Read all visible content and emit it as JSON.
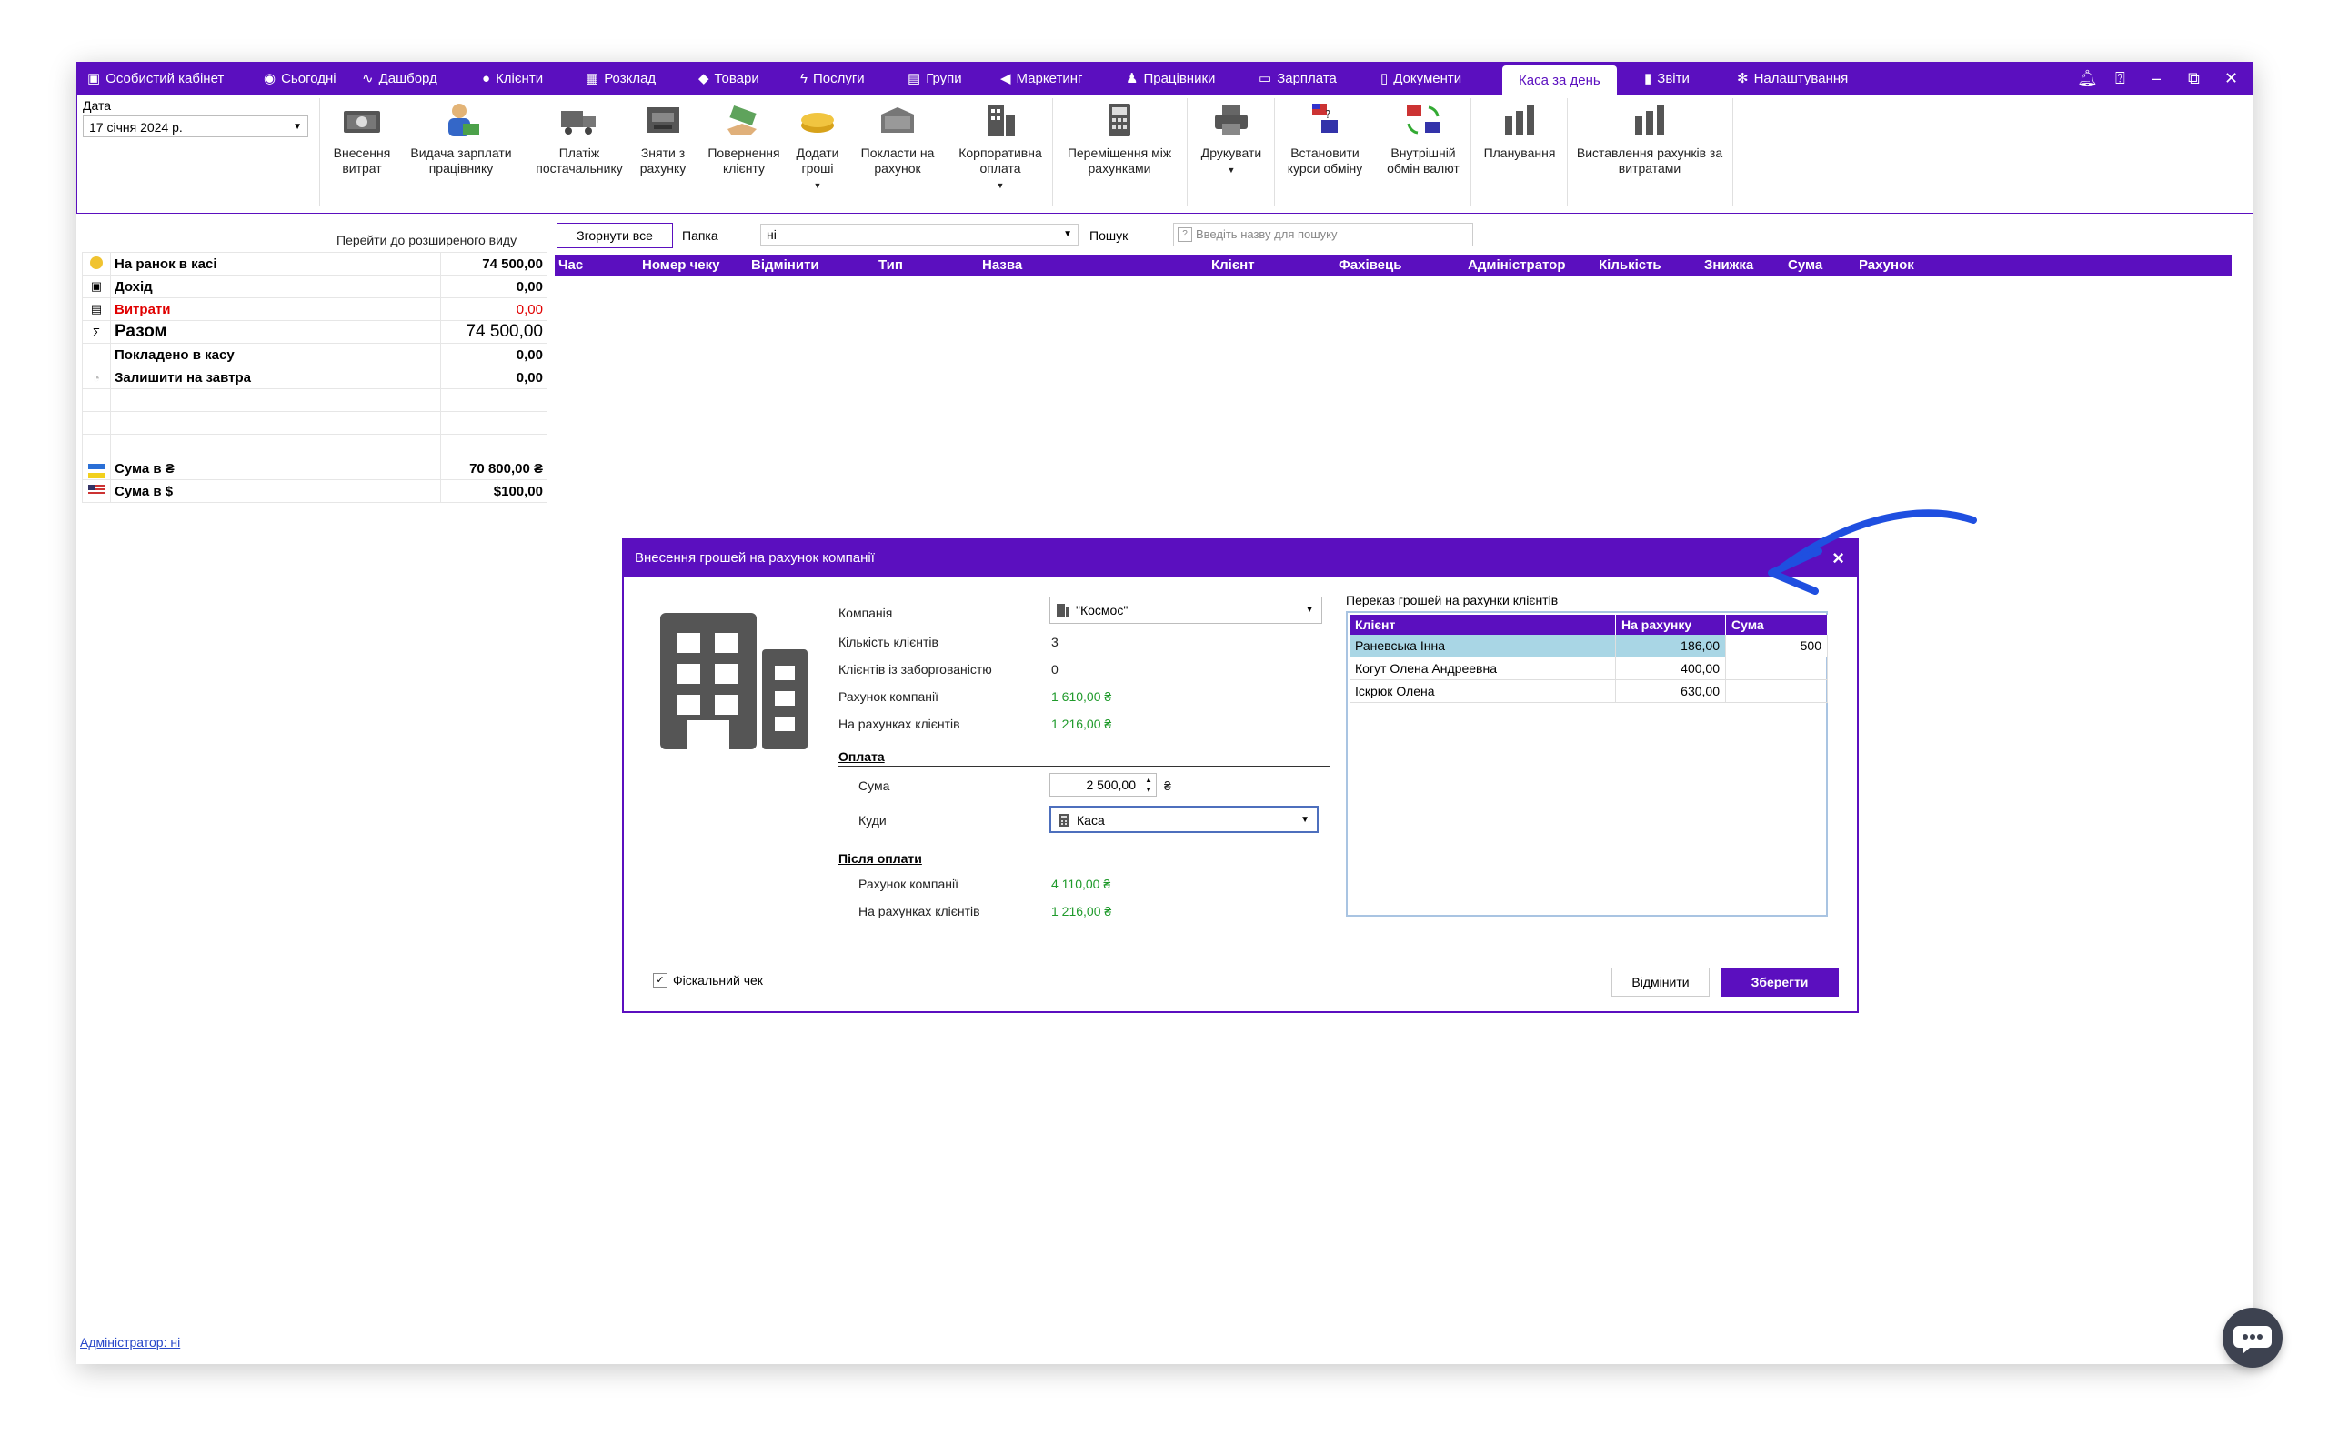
{
  "colors": {
    "accent": "#5b0fbf",
    "money_green": "#1f9a2b",
    "expense_red": "#e00000",
    "annotation_blue": "#1f4fe0"
  },
  "tabs": [
    {
      "label": "Особистий кабінет",
      "icon": "wallet-icon"
    },
    {
      "label": "Сьогодні",
      "icon": "today-icon"
    },
    {
      "label": "Дашборд",
      "icon": "pulse-icon"
    },
    {
      "label": "Клієнти",
      "icon": "user-circle-icon"
    },
    {
      "label": "Розклад",
      "icon": "calendar-icon"
    },
    {
      "label": "Товари",
      "icon": "box-icon"
    },
    {
      "label": "Послуги",
      "icon": "bolt-icon"
    },
    {
      "label": "Групи",
      "icon": "group-icon"
    },
    {
      "label": "Маркетинг",
      "icon": "megaphone-icon"
    },
    {
      "label": "Працівники",
      "icon": "person-icon"
    },
    {
      "label": "Зарплата",
      "icon": "cash-icon"
    },
    {
      "label": "Документи",
      "icon": "document-icon"
    },
    {
      "label": "Каса за день",
      "icon": ""
    },
    {
      "label": "Звіти",
      "icon": "bar-chart-icon"
    },
    {
      "label": "Налаштування",
      "icon": "gear-icon"
    }
  ],
  "ribbon": {
    "date_label": "Дата",
    "date_value": "17 січня 2024 р.",
    "buttons": [
      {
        "label": "Внесення витрат",
        "icon": "cash-note-icon"
      },
      {
        "label": "Видача зарплати працівнику",
        "icon": "worker-money-icon"
      },
      {
        "label": "Платіж постачальнику",
        "icon": "truck-icon"
      },
      {
        "label": "Зняти з рахунку",
        "icon": "atm-icon"
      },
      {
        "label": "Повернення клієнту",
        "icon": "hand-money-icon"
      },
      {
        "label": "Додати гроші",
        "icon": "coins-icon"
      },
      {
        "label": "Покласти на рахунок",
        "icon": "safe-icon"
      },
      {
        "label": "Корпоративна оплата",
        "icon": "building-icon"
      },
      {
        "label": "Переміщення між рахунками",
        "icon": "calculator-icon"
      },
      {
        "label": "Друкувати",
        "icon": "printer-icon"
      },
      {
        "label": "Встановити курси обміну",
        "icon": "exchange-rate-icon"
      },
      {
        "label": "Внутрішній обмін валют",
        "icon": "currency-swap-icon"
      },
      {
        "label": "Планування",
        "icon": "planning-chart-icon"
      },
      {
        "label": "Виставлення рахунків за витратами",
        "icon": "invoice-chart-icon"
      }
    ]
  },
  "left": {
    "extended_view_link": "Перейти до розширеного виду",
    "rows": [
      {
        "label": "На ранок в касі",
        "value": "74 500,00"
      },
      {
        "label": "Дохід",
        "value": "0,00"
      },
      {
        "label": "Витрати",
        "value": "0,00"
      },
      {
        "label": "Разом",
        "value": "74 500,00"
      },
      {
        "label": "Покладено в касу",
        "value": "0,00"
      },
      {
        "label": "Залишити на завтра",
        "value": "0,00"
      }
    ],
    "currency_rows": [
      {
        "label": "Сума в ₴",
        "value": "70 800,00 ₴",
        "icon": "flag-ua-icon"
      },
      {
        "label": "Сума в $",
        "value": "$100,00",
        "icon": "flag-us-icon"
      }
    ]
  },
  "toolbar": {
    "collapse_all": "Згорнути все",
    "folder_label": "Папка",
    "folder_value": "ні",
    "search_label": "Пошук",
    "search_placeholder": "Введіть назву для пошуку"
  },
  "grid": {
    "columns": [
      "Час",
      "Номер чеку",
      "Відмінити",
      "Тип",
      "Назва",
      "Клієнт",
      "Фахівець",
      "Адміністратор",
      "Кількість",
      "Знижка",
      "Сума",
      "Рахунок"
    ]
  },
  "footer": {
    "admin_link": "Адміністратор: ні"
  },
  "dialog": {
    "title": "Внесення грошей на рахунок компанії",
    "company_label": "Компанія",
    "company_value": "\"Космос\"",
    "clients_count_label": "Кількість клієнтів",
    "clients_count_value": "3",
    "debt_clients_label": "Клієнтів із заборгованістю",
    "debt_clients_value": "0",
    "company_account_label": "Рахунок компанії",
    "company_account_value": "1 610,00 ₴",
    "client_accounts_label": "На рахунках клієнтів",
    "client_accounts_value": "1 216,00 ₴",
    "payment_section": "Оплата",
    "sum_label": "Сума",
    "sum_value": "2 500,00",
    "sum_currency": "₴",
    "where_label": "Куди",
    "where_value": "Каса",
    "after_section": "Після оплати",
    "after_company_label": "Рахунок компанії",
    "after_company_value": "4 110,00 ₴",
    "after_clients_label": "На рахунках клієнтів",
    "after_clients_value": "1 216,00 ₴",
    "transfer_title": "Переказ грошей на рахунки клієнтів",
    "transfer_columns": [
      "Клієнт",
      "На рахунку",
      "Сума"
    ],
    "transfer_rows": [
      {
        "client": "Раневська Інна",
        "balance": "186,00",
        "sum": "500"
      },
      {
        "client": "Когут Олена Андреевна",
        "balance": "400,00",
        "sum": ""
      },
      {
        "client": "Іскрюк Олена",
        "balance": "630,00",
        "sum": ""
      }
    ],
    "fiscal_label": "Фіскальний чек",
    "fiscal_checked": true,
    "cancel_label": "Відмінити",
    "save_label": "Зберегти"
  }
}
